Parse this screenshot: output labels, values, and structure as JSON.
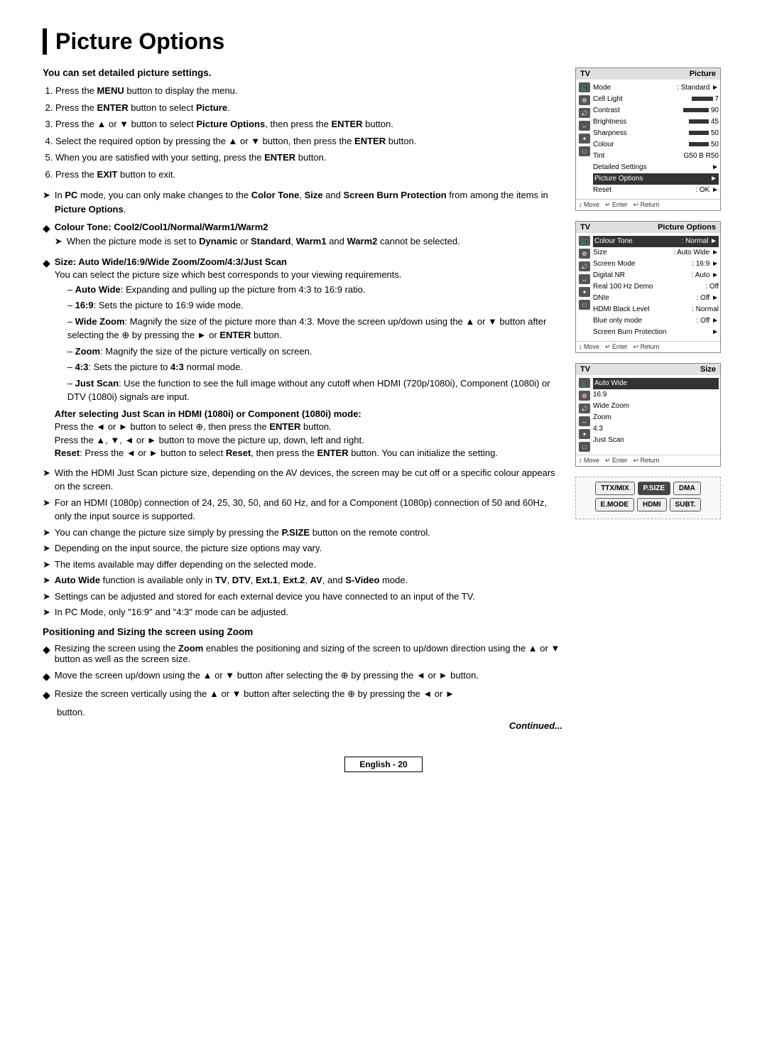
{
  "page": {
    "title": "Picture Options",
    "footer_label": "English - 20",
    "continued_text": "Continued..."
  },
  "intro": {
    "heading": "You can set detailed picture settings.",
    "steps": [
      {
        "num": "1",
        "text": "Press the ",
        "bold": "MENU",
        "rest": " button to display the menu."
      },
      {
        "num": "2",
        "text": "Press the ",
        "bold": "ENTER",
        "rest": " button to select ",
        "bold2": "Picture",
        "end": "."
      },
      {
        "num": "3",
        "text": "Press the ▲ or ▼ button to select ",
        "bold": "Picture Options",
        "rest": ", then press the ",
        "bold2": "ENTER",
        "end": " button."
      },
      {
        "num": "4",
        "text": "Select the required option by pressing the ▲ or ▼ button, then press the ",
        "bold": "ENTER",
        "rest": " button."
      },
      {
        "num": "5",
        "text": "When you are satisfied with your setting, press the ",
        "bold": "ENTER",
        "rest": " button."
      },
      {
        "num": "6",
        "text": "Press the ",
        "bold": "EXIT",
        "rest": " button to exit."
      }
    ]
  },
  "sections": {
    "pc_mode_note": "In PC mode, you can only make changes to the Color Tone, Size and Screen Burn Protection from among the items in Picture Options.",
    "colour_tone": {
      "header": "Colour Tone: Cool2/Cool1/Normal/Warm1/Warm2",
      "note": "When the picture mode is set to Dynamic or Standard, Warm1 and Warm2 cannot be selected."
    },
    "size": {
      "header": "Size: Auto Wide/16:9/Wide Zoom/Zoom/4:3/Just Scan",
      "intro": "You can select the picture size which best corresponds to your viewing requirements.",
      "items": [
        {
          "bold": "Auto Wide",
          "text": ": Expanding and pulling up the picture from 4:3 to 16:9 ratio."
        },
        {
          "bold": "16:9",
          "text": ": Sets the picture to 16:9 wide mode."
        },
        {
          "bold": "Wide Zoom",
          "text": ": Magnify the size of the picture more than 4:3. Move the screen up/down using the ▲ or ▼ button after selecting the  by pressing the ► or ENTER button."
        },
        {
          "bold": "Zoom",
          "text": ": Magnify the size of the picture vertically on screen."
        },
        {
          "bold": "4:3",
          "text": ": Sets the picture to 4:3 normal mode."
        },
        {
          "bold": "Just Scan",
          "text": ": Use the function to see the full image without any cutoff when HDMI (720p/1080i), Component (1080i) or DTV (1080i) signals are input."
        }
      ]
    },
    "after_just_scan": {
      "header": "After selecting Just Scan in HDMI (1080i) or Component (1080i) mode:",
      "lines": [
        "Press the ◄ or ► button to select , then press the ENTER button.",
        "Press the ▲, ▼, ◄ or ► button to move the picture up, down, left and right.",
        "Reset: Press the ◄ or ► button to select Reset, then press the ENTER button. You can initialize the setting."
      ]
    },
    "notes_list": [
      "With the HDMI Just Scan picture size, depending on the AV devices, the screen may be cut off or a specific colour appears on the screen.",
      "For an HDMI (1080p) connection of 24, 25, 30, 50, and 60 Hz, and for a Component (1080p) connection of 50 and 60Hz, only the input source is supported.",
      "You can change the picture size simply by pressing the P.SIZE button on the remote control.",
      "Depending on the input source, the picture size options may vary.",
      "The items available may differ depending on the selected mode.",
      "Auto Wide function is available only in TV, DTV, Ext.1, Ext.2, AV, and S-Video mode.",
      "Settings can be adjusted and stored for each external device you have connected to an input of the TV.",
      "In PC Mode, only \"16:9\" and \"4:3\" mode can be adjusted."
    ],
    "positioning": {
      "header": "Positioning and Sizing the screen using Zoom",
      "items": [
        "Resizing the screen using the Zoom enables the positioning and sizing of the screen to up/down direction using the ▲ or ▼ button as well as the screen size.",
        "Move the screen up/down using the ▲ or ▼ button after selecting the  by pressing the ◄ or ► button.",
        "Resize the screen vertically using the ▲ or ▼ button after selecting the  by pressing the ◄ or ► button."
      ]
    }
  },
  "tv_screens": {
    "screen1": {
      "title": "Picture",
      "rows": [
        {
          "label": "Mode",
          "value": ": Standard",
          "arrow": true
        },
        {
          "label": "Cell Light",
          "bar": true,
          "bar_val": "7"
        },
        {
          "label": "Contrast",
          "bar": true,
          "bar_val": "90"
        },
        {
          "label": "Brightness",
          "bar": true,
          "bar_val": "45"
        },
        {
          "label": "Sharpness",
          "bar": true,
          "bar_val": "50"
        },
        {
          "label": "Colour",
          "bar": true,
          "bar_val": "50"
        },
        {
          "label": "Tint",
          "value": "G50    B R50"
        },
        {
          "label": "Detailed Settings",
          "arrow": true
        },
        {
          "label": "Picture Options",
          "arrow": true,
          "highlight": true
        },
        {
          "label": "Reset",
          "value": ": OK",
          "arrow": true
        }
      ],
      "footer": [
        "↕ Move",
        "↵ Enter",
        "↩ Return"
      ]
    },
    "screen2": {
      "title": "Picture Options",
      "rows": [
        {
          "label": "Colour Tone",
          "value": ": Normal",
          "arrow": true,
          "highlight": true
        },
        {
          "label": "Size",
          "value": ": Auto Wide",
          "arrow": true
        },
        {
          "label": "Screen Mode",
          "value": ": 16:9",
          "arrow": true
        },
        {
          "label": "Digital NR",
          "value": ": Auto",
          "arrow": true
        },
        {
          "label": "Real 100 Hz Demo",
          "value": ": Off",
          "arrow": true
        },
        {
          "label": "DNIe",
          "value": ": Off",
          "arrow": true
        },
        {
          "label": "HDMI Black Level",
          "value": ": Normal"
        },
        {
          "label": "Blue only mode",
          "value": ": Off",
          "arrow": true
        },
        {
          "label": "Screen Burn Protection",
          "arrow": true
        }
      ],
      "footer": [
        "↕ Move",
        "↵ Enter",
        "↩ Return"
      ]
    },
    "screen3": {
      "title": "Size",
      "rows": [
        {
          "label": "Auto Wide",
          "highlight": true
        },
        {
          "label": "16:9"
        },
        {
          "label": "Wide Zoom"
        },
        {
          "label": "Zoom"
        },
        {
          "label": "4:3"
        },
        {
          "label": "Just Scan"
        }
      ],
      "footer": [
        "↕ Move",
        "↵ Enter",
        "↩ Return"
      ]
    }
  },
  "remote": {
    "row1": [
      "TTX/MIX",
      "P.SIZE",
      "DMA"
    ],
    "row2": [
      "E.MODE",
      "HDMI",
      "SUBT."
    ]
  }
}
